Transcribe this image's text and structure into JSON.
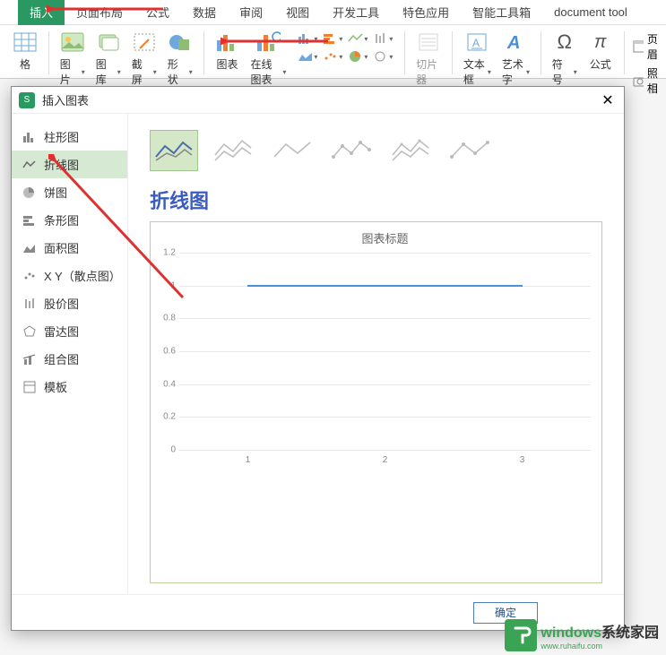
{
  "tabs": {
    "insert": "插入",
    "page_layout": "页面布局",
    "formula": "公式",
    "data": "数据",
    "review": "审阅",
    "view": "视图",
    "developer": "开发工具",
    "special": "特色应用",
    "smart_toolbox": "智能工具箱",
    "doc_tool": "document tool"
  },
  "ribbon": {
    "table_cell": "格",
    "picture": "图片",
    "gallery": "图库",
    "screenshot": "截屏",
    "shapes": "形状",
    "chart": "图表",
    "online_chart": "在线图表",
    "slicer": "切片器",
    "textbox": "文本框",
    "wordart": "艺术字",
    "symbol": "符号",
    "equation": "公式",
    "header_footer": "页眉",
    "camera": "照相"
  },
  "dialog": {
    "title": "插入图表",
    "sidebar": {
      "column": "柱形图",
      "line": "折线图",
      "pie": "饼图",
      "bar": "条形图",
      "area": "面积图",
      "scatter": "X Y（散点图）",
      "stock": "股价图",
      "radar": "雷达图",
      "combo": "组合图",
      "template": "模板"
    },
    "main_title": "折线图",
    "preview_title": "图表标题",
    "ok": "确定"
  },
  "watermark": {
    "main_left": "windows",
    "main_right": "系统家园",
    "sub": "www.ruhaifu.com"
  },
  "chart_data": {
    "type": "line",
    "title": "图表标题",
    "categories": [
      "1",
      "2",
      "3"
    ],
    "series": [
      {
        "name": "",
        "values": [
          1,
          1,
          1
        ]
      }
    ],
    "ylim": [
      0,
      1.2
    ],
    "yticks": [
      0,
      0.2,
      0.4,
      0.6,
      0.8,
      1,
      1.2
    ],
    "xlabel": "",
    "ylabel": ""
  }
}
